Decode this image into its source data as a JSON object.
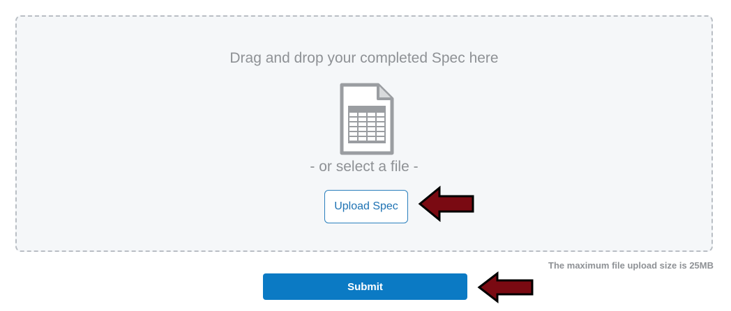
{
  "dropzone": {
    "title": "Drag and drop your completed Spec here",
    "icon": "spreadsheet-file-icon",
    "or_text": "- or select a file -",
    "upload_label": "Upload Spec"
  },
  "upload_limit_text": "The maximum file upload size is 25MB",
  "submit_label": "Submit",
  "annotations": {
    "arrow_icon": "left-arrow-icon",
    "arrow_color": "#7a0a12"
  },
  "colors": {
    "accent": "#0b7ac4",
    "dropzone_bg": "#f5f7f9",
    "muted_text": "#8e9195"
  }
}
